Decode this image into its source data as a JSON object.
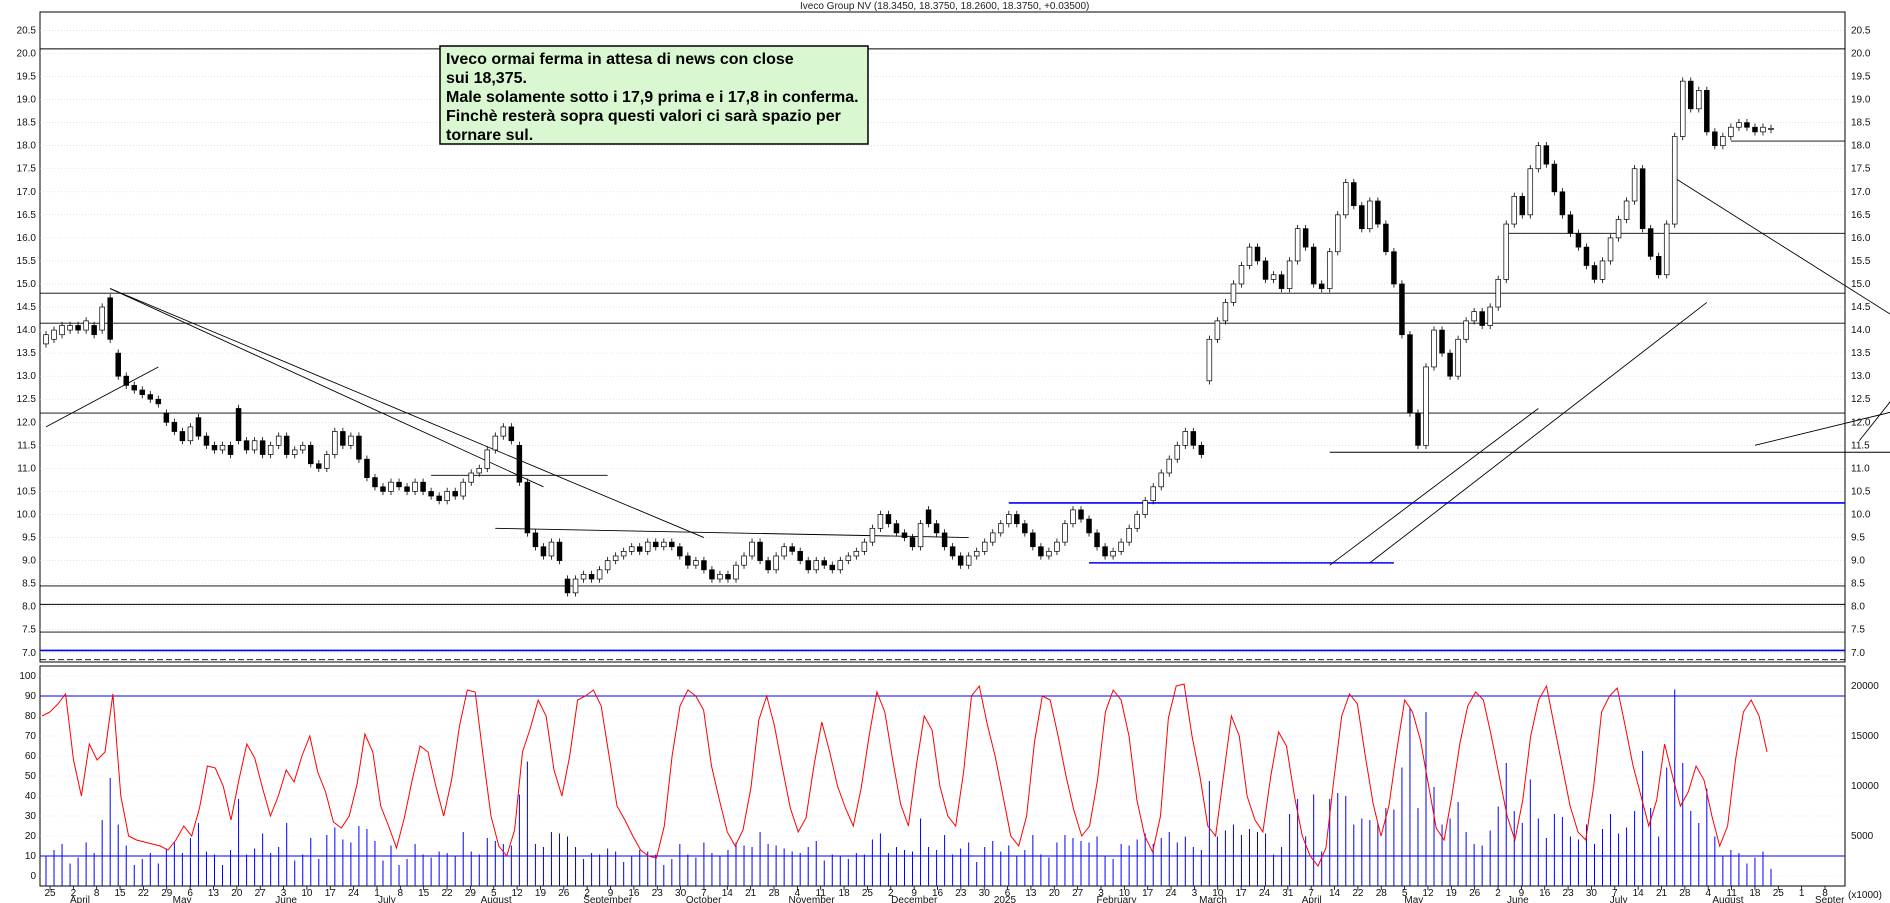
{
  "chart_data": {
    "type": "candlestick",
    "title": "Iveco Group NV (18.3450, 18.3750, 18.2600, 18.3750, +0.03500)",
    "annotation": [
      "Iveco ormai ferma in attesa di news con close",
      "sui 18,375.",
      "Male solamente sotto i 17,9 prima e i 17,8 in conferma.",
      "Finchè resterà sopra questi valori ci sarà spazio per",
      "tornare sul."
    ],
    "price_axis": {
      "ylim": [
        6.8,
        20.9
      ],
      "ticks": [
        "20.5",
        "20.0",
        "19.5",
        "19.0",
        "18.5",
        "18.0",
        "17.5",
        "17.0",
        "16.5",
        "16.0",
        "15.5",
        "15.0",
        "14.5",
        "14.0",
        "13.5",
        "13.0",
        "12.5",
        "12.0",
        "11.5",
        "11.0",
        "10.5",
        "10.0",
        "9.5",
        "9.0",
        "8.5",
        "8.0",
        "7.5",
        "7.0"
      ]
    },
    "oscillator_axis": {
      "ylim": [
        -5,
        105
      ],
      "ticks": [
        "100",
        "90",
        "80",
        "70",
        "60",
        "50",
        "40",
        "30",
        "20",
        "10",
        "0"
      ],
      "levels": [
        90,
        10
      ]
    },
    "volume_axis": {
      "ylim": [
        0,
        22000
      ],
      "ticks": [
        "20000",
        "15000",
        "10000",
        "5000"
      ],
      "unit": "(x1000)"
    },
    "date_labels": [
      "25",
      "2",
      "8",
      "15",
      "22",
      "29",
      "6",
      "13",
      "20",
      "27",
      "3",
      "10",
      "17",
      "24",
      "1",
      "8",
      "15",
      "22",
      "29",
      "5",
      "12",
      "19",
      "26",
      "2",
      "9",
      "16",
      "23",
      "30",
      "7",
      "14",
      "21",
      "28",
      "4",
      "11",
      "18",
      "25",
      "2",
      "9",
      "16",
      "23",
      "30",
      "6",
      "13",
      "20",
      "27",
      "3",
      "10",
      "17",
      "24",
      "3",
      "10",
      "17",
      "24",
      "31",
      "7",
      "14",
      "22",
      "28",
      "5",
      "12",
      "19",
      "26",
      "2",
      "9",
      "16",
      "23",
      "30",
      "7",
      "14",
      "21",
      "28",
      "4",
      "11",
      "18",
      "25",
      "1",
      "8"
    ],
    "month_labels": [
      "April",
      "May",
      "June",
      "July",
      "August",
      "September",
      "October",
      "November",
      "December",
      "2025",
      "February",
      "March",
      "April",
      "May",
      "June",
      "July",
      "August",
      "Septer"
    ],
    "horizontal_levels": [
      {
        "price": 20.1,
        "color": "#000000"
      },
      {
        "price": 18.1,
        "color": "#000000",
        "from_date": 210
      },
      {
        "price": 16.1,
        "color": "#000000",
        "from_date": 182
      },
      {
        "price": 14.8,
        "color": "#000000"
      },
      {
        "price": 14.15,
        "color": "#000000"
      },
      {
        "price": 12.2,
        "color": "#000000"
      },
      {
        "price": 11.35,
        "color": "#000000",
        "from_date": 160,
        "to_date": 240
      },
      {
        "price": 10.85,
        "color": "#000000",
        "from_date": 48,
        "to_date": 70
      },
      {
        "price": 10.25,
        "color": "#0000ff",
        "from_date": 120
      },
      {
        "price": 8.95,
        "color": "#0000ff",
        "from_date": 130,
        "to_date": 168
      },
      {
        "price": 8.45,
        "color": "#000000"
      },
      {
        "price": 8.05,
        "color": "#000000"
      },
      {
        "price": 7.45,
        "color": "#000000"
      },
      {
        "price": 7.05,
        "color": "#0000ff"
      },
      {
        "price": 6.85,
        "color": "#000000",
        "dashed": true
      }
    ],
    "trend_lines": [
      {
        "from": [
          8,
          14.9
        ],
        "to": [
          82,
          9.5
        ]
      },
      {
        "from": [
          8,
          14.9
        ],
        "to": [
          62,
          10.6
        ]
      },
      {
        "from": [
          0,
          11.9
        ],
        "to": [
          14,
          13.2
        ]
      },
      {
        "from": [
          56,
          9.7
        ],
        "to": [
          115,
          9.5
        ]
      },
      {
        "from": [
          165,
          8.95
        ],
        "to": [
          207,
          14.6
        ]
      },
      {
        "from": [
          203,
          17.3
        ],
        "to": [
          233,
          14.0
        ]
      },
      {
        "from": [
          213,
          11.5
        ],
        "to": [
          286,
          14.6
        ]
      },
      {
        "from": [
          226,
          11.6
        ],
        "to": [
          252,
          17.3
        ]
      },
      {
        "from": [
          238,
          18.1
        ],
        "to": [
          262,
          16.0
        ]
      },
      {
        "from": [
          160,
          8.9
        ],
        "to": [
          186,
          12.3
        ]
      }
    ],
    "candles": [
      [
        13.7,
        13.9
      ],
      [
        13.8,
        14.0
      ],
      [
        13.9,
        14.1
      ],
      [
        14.0,
        14.1
      ],
      [
        14.1,
        14.0
      ],
      [
        14.0,
        14.2
      ],
      [
        14.1,
        13.9
      ],
      [
        14.0,
        14.5
      ],
      [
        14.7,
        13.8
      ],
      [
        13.5,
        13.0
      ],
      [
        13.0,
        12.8
      ],
      [
        12.8,
        12.7
      ],
      [
        12.7,
        12.6
      ],
      [
        12.6,
        12.5
      ],
      [
        12.5,
        12.4
      ],
      [
        12.2,
        12.0
      ],
      [
        12.0,
        11.8
      ],
      [
        11.8,
        11.6
      ],
      [
        11.6,
        11.9
      ],
      [
        12.1,
        11.7
      ],
      [
        11.7,
        11.5
      ],
      [
        11.5,
        11.4
      ],
      [
        11.4,
        11.5
      ],
      [
        11.5,
        11.3
      ],
      [
        12.3,
        11.6
      ],
      [
        11.6,
        11.4
      ],
      [
        11.4,
        11.6
      ],
      [
        11.6,
        11.3
      ],
      [
        11.3,
        11.5
      ],
      [
        11.5,
        11.7
      ],
      [
        11.7,
        11.3
      ],
      [
        11.3,
        11.4
      ],
      [
        11.4,
        11.5
      ],
      [
        11.5,
        11.1
      ],
      [
        11.1,
        11.0
      ],
      [
        11.0,
        11.3
      ],
      [
        11.3,
        11.8
      ],
      [
        11.8,
        11.5
      ],
      [
        11.5,
        11.7
      ],
      [
        11.7,
        11.2
      ],
      [
        11.2,
        10.8
      ],
      [
        10.8,
        10.6
      ],
      [
        10.6,
        10.5
      ],
      [
        10.5,
        10.7
      ],
      [
        10.7,
        10.6
      ],
      [
        10.6,
        10.5
      ],
      [
        10.5,
        10.7
      ],
      [
        10.7,
        10.5
      ],
      [
        10.5,
        10.4
      ],
      [
        10.4,
        10.3
      ],
      [
        10.3,
        10.5
      ],
      [
        10.5,
        10.4
      ],
      [
        10.4,
        10.7
      ],
      [
        10.7,
        10.9
      ],
      [
        10.9,
        11.0
      ],
      [
        11.0,
        11.4
      ],
      [
        11.4,
        11.7
      ],
      [
        11.7,
        11.9
      ],
      [
        11.9,
        11.6
      ],
      [
        11.5,
        10.7
      ],
      [
        10.7,
        9.6
      ],
      [
        9.6,
        9.3
      ],
      [
        9.3,
        9.1
      ],
      [
        9.1,
        9.4
      ],
      [
        9.4,
        9.0
      ],
      [
        8.6,
        8.3
      ],
      [
        8.3,
        8.6
      ],
      [
        8.6,
        8.7
      ],
      [
        8.7,
        8.6
      ],
      [
        8.6,
        8.8
      ],
      [
        8.8,
        9.0
      ],
      [
        9.0,
        9.1
      ],
      [
        9.1,
        9.2
      ],
      [
        9.2,
        9.3
      ],
      [
        9.3,
        9.2
      ],
      [
        9.2,
        9.4
      ],
      [
        9.4,
        9.3
      ],
      [
        9.3,
        9.4
      ],
      [
        9.4,
        9.3
      ],
      [
        9.3,
        9.1
      ],
      [
        9.1,
        8.9
      ],
      [
        8.9,
        9.0
      ],
      [
        9.0,
        8.8
      ],
      [
        8.8,
        8.6
      ],
      [
        8.6,
        8.7
      ],
      [
        8.7,
        8.6
      ],
      [
        8.6,
        8.9
      ],
      [
        8.9,
        9.1
      ],
      [
        9.1,
        9.4
      ],
      [
        9.4,
        9.0
      ],
      [
        9.0,
        8.8
      ],
      [
        8.8,
        9.1
      ],
      [
        9.1,
        9.3
      ],
      [
        9.3,
        9.2
      ],
      [
        9.2,
        9.0
      ],
      [
        9.0,
        8.8
      ],
      [
        8.8,
        9.0
      ],
      [
        9.0,
        8.9
      ],
      [
        8.9,
        8.8
      ],
      [
        8.8,
        9.0
      ],
      [
        9.0,
        9.1
      ],
      [
        9.1,
        9.2
      ],
      [
        9.2,
        9.4
      ],
      [
        9.4,
        9.7
      ],
      [
        9.7,
        10.0
      ],
      [
        10.0,
        9.8
      ],
      [
        9.8,
        9.6
      ],
      [
        9.6,
        9.5
      ],
      [
        9.5,
        9.3
      ],
      [
        9.3,
        9.8
      ],
      [
        10.1,
        9.8
      ],
      [
        9.8,
        9.6
      ],
      [
        9.6,
        9.3
      ],
      [
        9.3,
        9.1
      ],
      [
        9.1,
        8.9
      ],
      [
        8.9,
        9.1
      ],
      [
        9.1,
        9.2
      ],
      [
        9.2,
        9.4
      ],
      [
        9.4,
        9.6
      ],
      [
        9.6,
        9.8
      ],
      [
        9.8,
        10.0
      ],
      [
        10.0,
        9.8
      ],
      [
        9.8,
        9.6
      ],
      [
        9.6,
        9.3
      ],
      [
        9.3,
        9.1
      ],
      [
        9.1,
        9.2
      ],
      [
        9.2,
        9.4
      ],
      [
        9.4,
        9.8
      ],
      [
        9.8,
        10.1
      ],
      [
        10.1,
        9.9
      ],
      [
        9.9,
        9.6
      ],
      [
        9.6,
        9.3
      ],
      [
        9.3,
        9.1
      ],
      [
        9.1,
        9.2
      ],
      [
        9.2,
        9.4
      ],
      [
        9.4,
        9.7
      ],
      [
        9.7,
        10.0
      ],
      [
        10.0,
        10.3
      ],
      [
        10.3,
        10.6
      ],
      [
        10.6,
        10.9
      ],
      [
        10.9,
        11.2
      ],
      [
        11.2,
        11.5
      ],
      [
        11.5,
        11.8
      ],
      [
        11.8,
        11.5
      ],
      [
        11.5,
        11.3
      ],
      [
        12.9,
        13.8
      ],
      [
        13.8,
        14.2
      ],
      [
        14.2,
        14.6
      ],
      [
        14.6,
        15.0
      ],
      [
        15.0,
        15.4
      ],
      [
        15.4,
        15.8
      ],
      [
        15.8,
        15.5
      ],
      [
        15.5,
        15.1
      ],
      [
        15.1,
        15.2
      ],
      [
        15.2,
        14.9
      ],
      [
        14.9,
        15.5
      ],
      [
        15.5,
        16.2
      ],
      [
        16.2,
        15.8
      ],
      [
        15.8,
        15.0
      ],
      [
        15.0,
        14.9
      ],
      [
        14.9,
        15.7
      ],
      [
        15.7,
        16.5
      ],
      [
        16.5,
        17.2
      ],
      [
        17.2,
        16.7
      ],
      [
        16.7,
        16.2
      ],
      [
        16.2,
        16.8
      ],
      [
        16.8,
        16.3
      ],
      [
        16.3,
        15.7
      ],
      [
        15.7,
        15.0
      ],
      [
        15.0,
        13.9
      ],
      [
        13.9,
        12.2
      ],
      [
        12.2,
        11.5
      ],
      [
        11.5,
        13.2
      ],
      [
        13.2,
        14.0
      ],
      [
        14.0,
        13.5
      ],
      [
        13.5,
        13.0
      ],
      [
        13.0,
        13.8
      ],
      [
        13.8,
        14.2
      ],
      [
        14.2,
        14.4
      ],
      [
        14.4,
        14.1
      ],
      [
        14.1,
        14.5
      ],
      [
        14.5,
        15.1
      ],
      [
        15.1,
        16.3
      ],
      [
        16.3,
        16.9
      ],
      [
        16.9,
        16.5
      ],
      [
        16.5,
        17.5
      ],
      [
        17.5,
        18.0
      ],
      [
        18.0,
        17.6
      ],
      [
        17.6,
        17.0
      ],
      [
        17.0,
        16.5
      ],
      [
        16.5,
        16.1
      ],
      [
        16.1,
        15.8
      ],
      [
        15.8,
        15.4
      ],
      [
        15.4,
        15.1
      ],
      [
        15.1,
        15.5
      ],
      [
        15.5,
        16.0
      ],
      [
        16.0,
        16.4
      ],
      [
        16.4,
        16.8
      ],
      [
        16.8,
        17.5
      ],
      [
        17.5,
        16.2
      ],
      [
        16.2,
        15.6
      ],
      [
        15.6,
        15.2
      ],
      [
        15.2,
        16.3
      ],
      [
        16.3,
        18.2
      ],
      [
        18.2,
        19.4
      ],
      [
        19.4,
        18.8
      ],
      [
        18.8,
        19.2
      ],
      [
        19.2,
        18.3
      ],
      [
        18.3,
        18.0
      ],
      [
        18.0,
        18.2
      ],
      [
        18.2,
        18.4
      ],
      [
        18.4,
        18.5
      ],
      [
        18.5,
        18.4
      ],
      [
        18.4,
        18.3
      ],
      [
        18.3,
        18.4
      ],
      [
        18.35,
        18.375
      ]
    ],
    "oscillator": [
      80,
      82,
      86,
      91,
      58,
      40,
      66,
      58,
      62,
      91,
      40,
      20,
      18,
      17,
      16,
      15,
      13,
      18,
      25,
      20,
      34,
      55,
      54,
      45,
      28,
      48,
      66,
      59,
      44,
      30,
      40,
      53,
      47,
      60,
      70,
      52,
      42,
      27,
      24,
      30,
      46,
      71,
      62,
      35,
      25,
      14,
      29,
      48,
      65,
      62,
      45,
      30,
      48,
      75,
      93,
      92,
      60,
      30,
      15,
      10,
      23,
      62,
      74,
      88,
      80,
      53,
      40,
      60,
      88,
      90,
      93,
      85,
      60,
      35,
      28,
      20,
      13,
      10,
      9,
      25,
      60,
      85,
      93,
      90,
      83,
      55,
      38,
      22,
      15,
      23,
      44,
      78,
      90,
      75,
      54,
      34,
      22,
      29,
      55,
      77,
      62,
      45,
      34,
      25,
      44,
      70,
      92,
      82,
      58,
      36,
      25,
      55,
      80,
      73,
      45,
      30,
      25,
      52,
      90,
      95,
      76,
      60,
      40,
      20,
      15,
      30,
      67,
      90,
      88,
      70,
      50,
      33,
      20,
      25,
      48,
      82,
      93,
      88,
      70,
      38,
      20,
      12,
      30,
      79,
      95,
      96,
      70,
      50,
      25,
      20,
      50,
      80,
      70,
      40,
      28,
      22,
      50,
      72,
      65,
      40,
      20,
      10,
      5,
      14,
      48,
      80,
      91,
      86,
      60,
      36,
      20,
      35,
      63,
      88,
      82,
      68,
      46,
      24,
      18,
      40,
      66,
      85,
      92,
      88,
      70,
      50,
      30,
      18,
      38,
      70,
      88,
      95,
      75,
      55,
      35,
      22,
      18,
      45,
      82,
      90,
      94,
      75,
      55,
      40,
      25,
      38,
      66,
      50,
      35,
      42,
      55,
      48,
      30,
      15,
      25,
      58,
      82,
      88,
      80,
      62
    ]
  }
}
